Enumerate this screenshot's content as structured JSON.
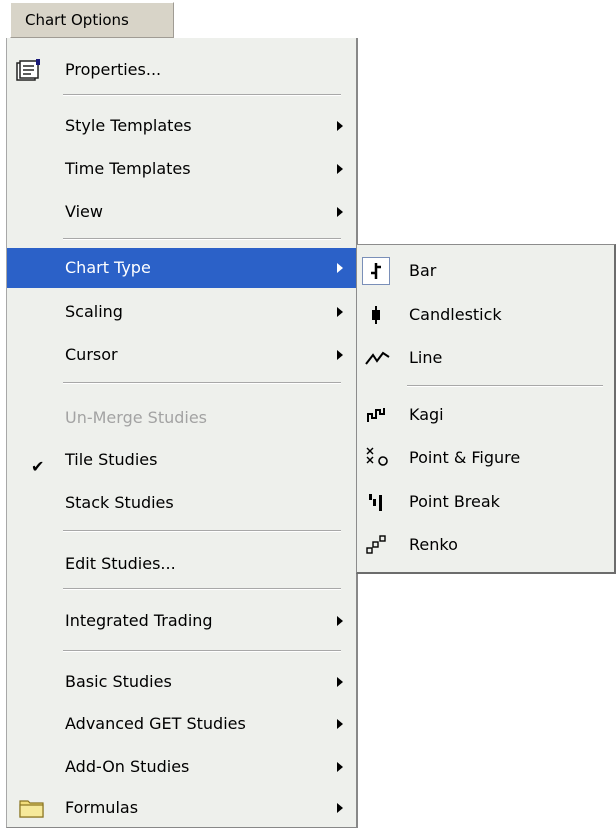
{
  "menu_title": "Chart Options",
  "main_menu": {
    "properties": "Properties...",
    "style_templates": "Style Templates",
    "time_templates": "Time Templates",
    "view": "View",
    "chart_type": "Chart Type",
    "scaling": "Scaling",
    "cursor": "Cursor",
    "unmerge_studies": "Un-Merge Studies",
    "tile_studies": "Tile Studies",
    "stack_studies": "Stack Studies",
    "edit_studies": "Edit Studies...",
    "integrated_trading": "Integrated Trading",
    "basic_studies": "Basic Studies",
    "advanced_get_studies": "Advanced GET Studies",
    "addon_studies": "Add-On Studies",
    "formulas": "Formulas"
  },
  "chart_type_submenu": {
    "bar": "Bar",
    "candlestick": "Candlestick",
    "line": "Line",
    "kagi": "Kagi",
    "point_figure": "Point & Figure",
    "point_break": "Point Break",
    "renko": "Renko"
  },
  "state": {
    "highlighted_item": "Chart Type",
    "checked_item": "Tile Studies",
    "disabled_item": "Un-Merge Studies"
  },
  "colors": {
    "menu_background": "#eef0ec",
    "highlight": "#2b61c8",
    "disabled_text": "#a3a3a3"
  }
}
